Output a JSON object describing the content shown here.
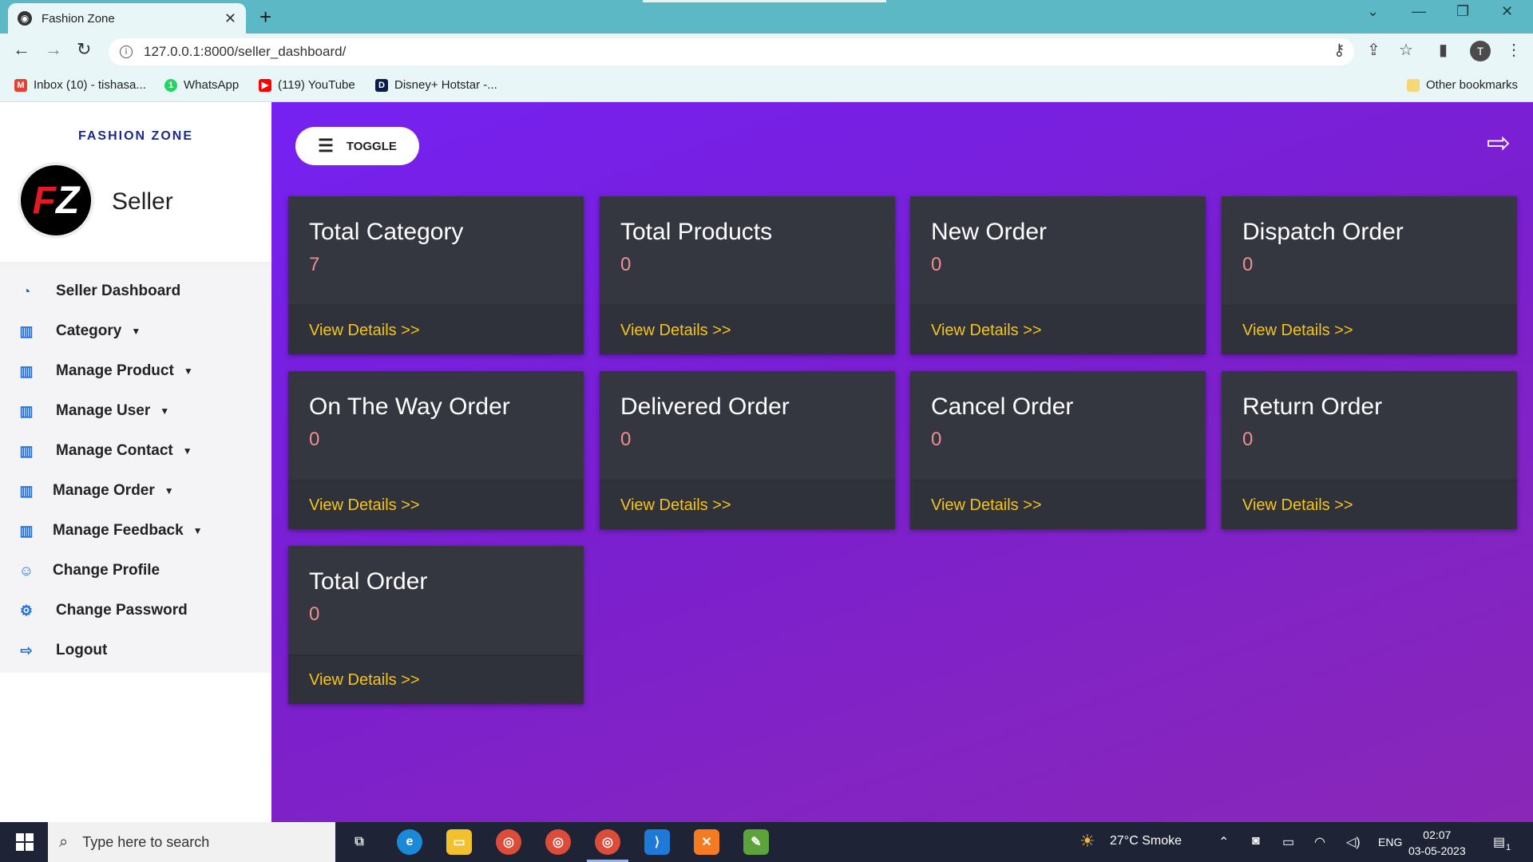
{
  "browser": {
    "tab_title": "Fashion Zone",
    "url": "127.0.0.1:8000/seller_dashboard/",
    "bookmarks": [
      {
        "label": "Inbox (10) - tishasa...",
        "icon": "gmail-icon",
        "color": "#e34133"
      },
      {
        "label": "WhatsApp",
        "icon": "whatsapp-icon",
        "color": "#25d366"
      },
      {
        "label": "(119) YouTube",
        "icon": "youtube-icon",
        "color": "#ff0000"
      },
      {
        "label": "Disney+ Hotstar -...",
        "icon": "hotstar-icon",
        "color": "#0b1c4a"
      }
    ],
    "other_bookmarks": "Other bookmarks",
    "profile_initial": "T"
  },
  "sidebar": {
    "brand": "FASHION ZONE",
    "user_role": "Seller",
    "logo_letters": "FZ",
    "items": [
      {
        "label": "Seller Dashboard",
        "icon": "dashboard-icon",
        "dropdown": false
      },
      {
        "label": "Category",
        "icon": "chart-bar-icon",
        "dropdown": true
      },
      {
        "label": "Manage Product",
        "icon": "chart-bar-icon",
        "dropdown": true
      },
      {
        "label": "Manage User",
        "icon": "chart-bar-icon",
        "dropdown": true
      },
      {
        "label": "Manage Contact",
        "icon": "chart-bar-icon",
        "dropdown": true
      },
      {
        "label": "Manage Order",
        "icon": "chart-bar-icon",
        "dropdown": true
      },
      {
        "label": "Manage Feedback",
        "icon": "chart-bar-icon",
        "dropdown": true
      },
      {
        "label": "Change Profile",
        "icon": "user-icon",
        "dropdown": false
      },
      {
        "label": "Change Password",
        "icon": "gear-icon",
        "dropdown": false
      },
      {
        "label": "Logout",
        "icon": "logout-icon",
        "dropdown": false
      }
    ]
  },
  "main": {
    "toggle_label": "TOGGLE",
    "cards": [
      {
        "title": "Total Category",
        "value": "7",
        "link": "View Details >>"
      },
      {
        "title": "Total Products",
        "value": "0",
        "link": "View Details >>"
      },
      {
        "title": "New Order",
        "value": "0",
        "link": "View Details >>"
      },
      {
        "title": "Dispatch Order",
        "value": "0",
        "link": "View Details >>"
      },
      {
        "title": "On The Way Order",
        "value": "0",
        "link": "View Details >>"
      },
      {
        "title": "Delivered Order",
        "value": "0",
        "link": "View Details >>"
      },
      {
        "title": "Cancel Order",
        "value": "0",
        "link": "View Details >>"
      },
      {
        "title": "Return Order",
        "value": "0",
        "link": "View Details >>"
      },
      {
        "title": "Total Order",
        "value": "0",
        "link": "View Details >>"
      }
    ]
  },
  "taskbar": {
    "search_placeholder": "Type here to search",
    "weather": "27°C  Smoke",
    "language": "ENG",
    "time": "02:07",
    "date": "03-05-2023",
    "notifications": "1"
  },
  "colors": {
    "accent_link": "#f5c518",
    "card_bg": "#343640",
    "value_color": "#f08f8f",
    "brand_blue": "#1b2a8c"
  }
}
